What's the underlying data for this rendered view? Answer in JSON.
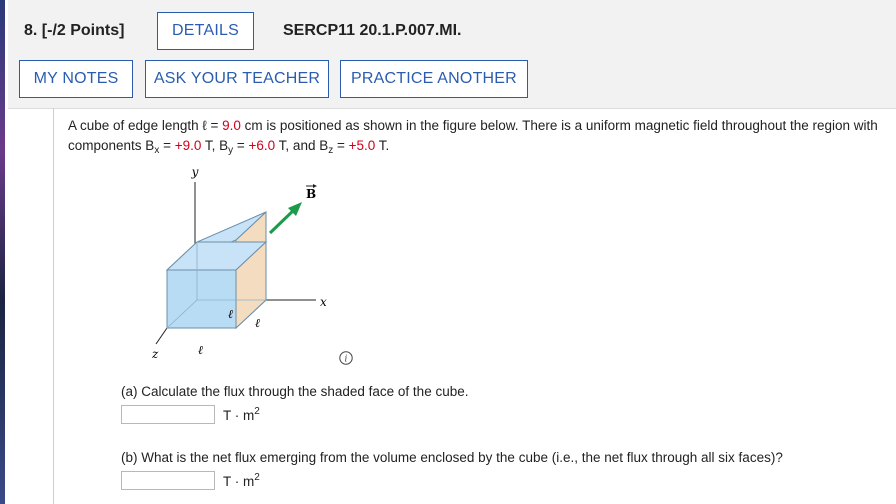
{
  "header": {
    "question_number": "8.  [-/2 Points]",
    "details_label": "DETAILS",
    "question_code": "SERCP11 20.1.P.007.MI.",
    "my_notes_label": "MY NOTES",
    "ask_teacher_label": "ASK YOUR TEACHER",
    "practice_another_label": "PRACTICE ANOTHER"
  },
  "problem": {
    "intro": "A cube of edge length ℓ = ",
    "edge_value": "9.0",
    "text_2": " cm is positioned as shown in the figure below. There is a uniform magnetic field throughout the region with components B",
    "bx_sub": "x",
    "text_3": " = ",
    "bx_value": "+9.0",
    "text_4": " T, B",
    "by_sub": "y",
    "text_5": " = ",
    "by_value": "+6.0",
    "text_6": " T, and B",
    "bz_sub": "z",
    "text_7": " = ",
    "bz_value": "+5.0",
    "text_8": " T."
  },
  "figure": {
    "y_label": "y",
    "x_label": "x",
    "z_label": "z",
    "b_label": "B",
    "edge_label": "ℓ"
  },
  "parts": {
    "a_text": "(a) Calculate the flux through the shaded face of the cube.",
    "b_text": "(b) What is the net flux emerging from the volume enclosed by the cube (i.e., the net flux through all six faces)?",
    "unit_base": "T · m",
    "unit_exp": "2",
    "a_value": "",
    "b_value": ""
  },
  "colors": {
    "button_blue": "#2a5db0",
    "red_value": "#d0021b",
    "arrow_green": "#1a9a4a",
    "cube_blue": "#b9dcf5",
    "shaded_face": "#f3dcc0"
  }
}
